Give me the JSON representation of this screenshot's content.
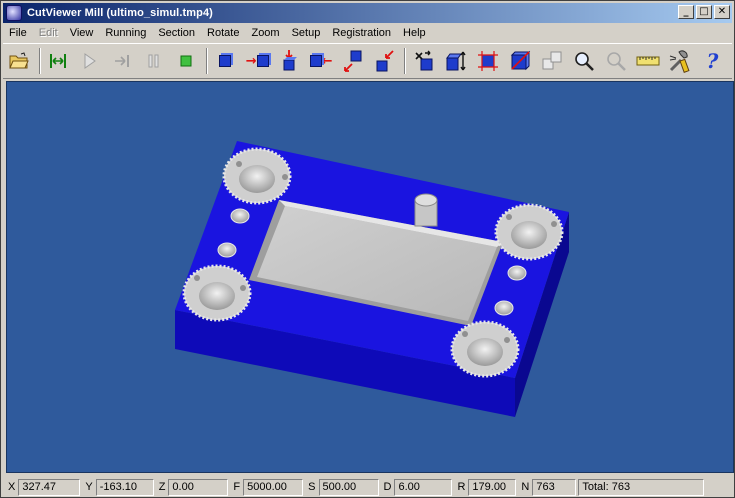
{
  "window": {
    "title": "CutViewer Mill (ultimo_simul.tmp4)",
    "controls": {
      "minimize": "_",
      "maximize": "□",
      "close": "✕"
    }
  },
  "menu": {
    "items": [
      {
        "label": "File",
        "enabled": true
      },
      {
        "label": "Edit",
        "enabled": false
      },
      {
        "label": "View",
        "enabled": true
      },
      {
        "label": "Running",
        "enabled": true
      },
      {
        "label": "Section",
        "enabled": true
      },
      {
        "label": "Rotate",
        "enabled": true
      },
      {
        "label": "Zoom",
        "enabled": true
      },
      {
        "label": "Setup",
        "enabled": true
      },
      {
        "label": "Registration",
        "enabled": true
      },
      {
        "label": "Help",
        "enabled": true
      }
    ]
  },
  "toolbar": {
    "icons": [
      "open-folder-icon",
      "rewind-to-start-icon",
      "play-icon",
      "step-forward-icon",
      "pause-icon",
      "stop-icon",
      "view-iso-icon",
      "view-front-icon",
      "view-top-icon",
      "view-right-icon",
      "view-left-rear-icon",
      "view-bottom-icon",
      "rotate-view-icon",
      "stretch-height-icon",
      "fit-window-icon",
      "section-plane-icon",
      "section-copy-icon",
      "zoom-icon",
      "measure-point-icon",
      "ruler-icon",
      "tools-settings-icon",
      "help-icon"
    ],
    "colors": {
      "cube_blue": "#1e3ccc",
      "arrow_red": "#e01010",
      "help_blue": "#2040d0"
    }
  },
  "viewport": {
    "background": "#2f5a9c",
    "part_color": "#1a14dc",
    "pocket_color": "#c8c8c8"
  },
  "status": {
    "x_label": "X",
    "x_value": "327.47",
    "y_label": "Y",
    "y_value": "-163.10",
    "z_label": "Z",
    "z_value": "0.00",
    "f_label": "F",
    "f_value": "5000.00",
    "s_label": "S",
    "s_value": "500.00",
    "d_label": "D",
    "d_value": "6.00",
    "r_label": "R",
    "r_value": "179.00",
    "n_label": "N",
    "n_value": "763",
    "total": "Total: 763"
  }
}
